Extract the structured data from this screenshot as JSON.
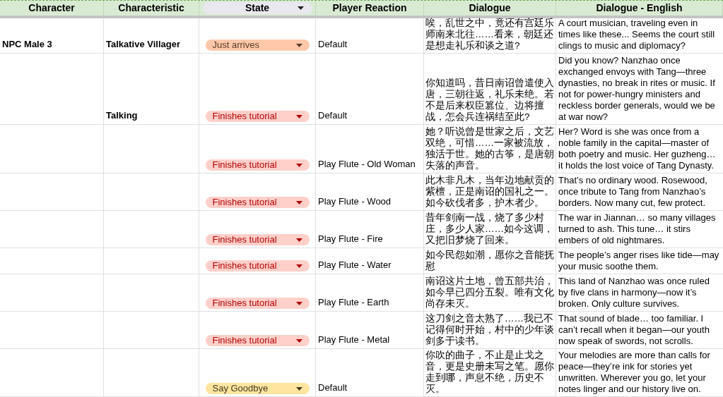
{
  "columns": [
    {
      "label": "Character"
    },
    {
      "label": "Characteristic"
    },
    {
      "label": "State",
      "filter": true
    },
    {
      "label": "Player Reaction"
    },
    {
      "label": "Dialogue"
    },
    {
      "label": "Dialogue - English"
    }
  ],
  "rows": [
    {
      "character": "NPC Male 3",
      "characteristic": "Talkative Villager",
      "state": {
        "label": "Just arrives",
        "color": "#ffc8aa"
      },
      "reaction": "Default",
      "dialogue": "唉，乱世之中，竟还有宫廷乐师南来北往……看来，朝廷还是想走礼乐和谈之道?",
      "english": "A court musician, traveling even in times like these... Seems the court still clings to music and diplomacy?"
    },
    {
      "characteristic": "Talking",
      "state": {
        "label": "Finishes tutorial",
        "color": "#ffcfc9"
      },
      "reaction": "Default",
      "dialogue": "你知道吗，昔日南诏曾遣使入唐，三朝往返，礼乐未绝。若不是后来权臣篡位、边将擅战，怎会兵连祸结至此?",
      "english": "Did you know? Nanzhao once exchanged envoys with Tang—three dynasties, no break in rites or music. If not for power-hungry ministers and reckless border generals, would we be at war now?"
    },
    {
      "state": {
        "label": "Finishes tutorial",
        "color": "#ffcfc9"
      },
      "reaction": "Play Flute - Old Woman",
      "dialogue": "她？听说曾是世家之后，文艺双绝，可惜……一家被流放，独活于世。她的古筝，是唐朝失落的声音。",
      "english": "Her? Word is she was once from a noble family in the capital—master of both poetry and music. Her guzheng… it holds the lost voice of Tang Dynasty."
    },
    {
      "state": {
        "label": "Finishes tutorial",
        "color": "#ffcfc9"
      },
      "reaction": "Play Flute - Wood",
      "dialogue": "此木非凡木，当年边地献贡的紫檀，正是南诏的国礼之一。如今砍伐者多，护木者少。",
      "english": "That’s no ordinary wood. Rosewood, once tribute to Tang from Nanzhao’s borders. Now many cut, few protect."
    },
    {
      "state": {
        "label": "Finishes tutorial",
        "color": "#ffcfc9"
      },
      "reaction": "Play Flute - Fire",
      "dialogue": "昔年剑南一战，烧了多少村庄，多少人家……如今这调，又把旧梦烧了回来。",
      "english": "The war in Jiannan… so many villages turned to ash. This tune… it stirs embers of old nightmares."
    },
    {
      "state": {
        "label": "Finishes tutorial",
        "color": "#ffcfc9"
      },
      "reaction": "Play Flute - Water",
      "dialogue": "如今民怨如潮，愿你之音能抚慰",
      "english": "The people’s anger rises like tide—may your music soothe them."
    },
    {
      "state": {
        "label": "Finishes tutorial",
        "color": "#ffcfc9"
      },
      "reaction": "Play Flute - Earth",
      "dialogue": "南诏这片土地，曾五部共治，如今早已四分五裂。唯有文化尚存未灭。",
      "english": "This land of Nanzhao was once ruled by five clans in harmony—now it’s broken. Only culture survives."
    },
    {
      "state": {
        "label": "Finishes tutorial",
        "color": "#ffcfc9"
      },
      "reaction": "Play Flute - Metal",
      "dialogue": "这刀剑之音太熟了……我已不记得何时开始，村中的少年谈剑多于读书。",
      "english": "That sound of blade… too familiar. I can’t recall when it began—our youth now speak of swords, not scrolls."
    },
    {
      "state": {
        "label": "Say Goodbye",
        "color": "#ffe5a0"
      },
      "reaction": "Default",
      "dialogue": "你吹的曲子，不止是止戈之音，更是史册未写之笔。愿你走到哪，声息不绝，历史不灭。",
      "english": "Your melodies are more than calls for peace—they’re ink for stories yet unwritten. Wherever you go, let your notes linger and our history live on."
    }
  ]
}
